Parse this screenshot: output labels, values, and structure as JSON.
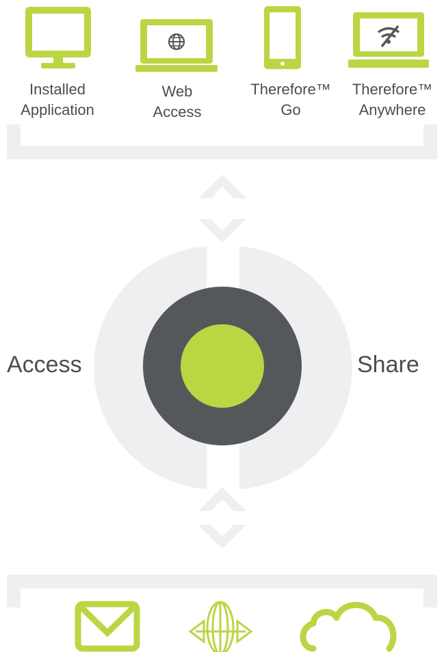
{
  "colors": {
    "accent": "#bad643",
    "dark": "#55585b",
    "light_gray": "#efeff1",
    "text": "#4a4d51"
  },
  "top_items": [
    {
      "icon": "desktop-monitor-icon",
      "line1": "Installed",
      "line2": "Application"
    },
    {
      "icon": "laptop-globe-icon",
      "line1": "Web",
      "line2": "Access"
    },
    {
      "icon": "tablet-icon",
      "line1": "Therefore™",
      "line2": "Go"
    },
    {
      "icon": "laptop-no-wifi-icon",
      "line1": "Therefore™",
      "line2": "Anywhere"
    }
  ],
  "center": {
    "left_label": "Access",
    "right_label": "Share"
  },
  "bottom_items": [
    {
      "icon": "mail-envelope-icon"
    },
    {
      "icon": "exchange-globe-icon"
    },
    {
      "icon": "cloud-icon"
    }
  ]
}
